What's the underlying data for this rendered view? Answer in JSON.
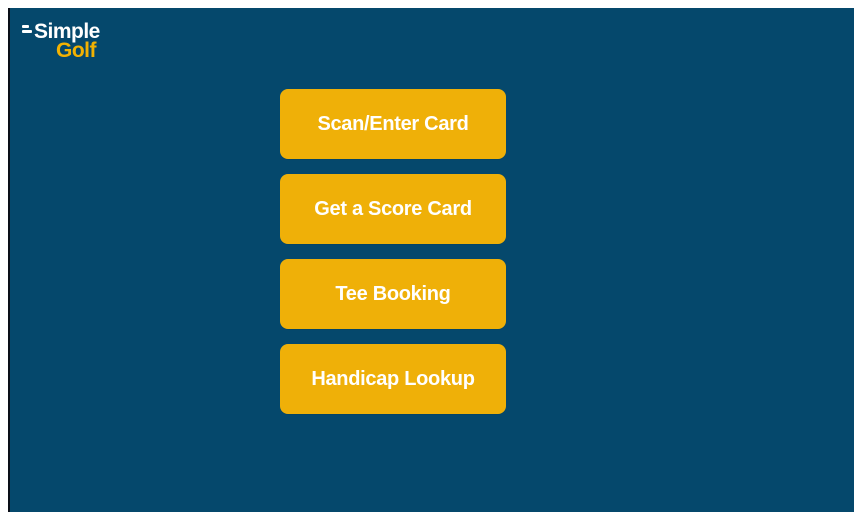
{
  "theme": {
    "background": "#05486c",
    "button": "#efb008",
    "button_text": "#ffffff",
    "logo_primary": "#ffffff",
    "logo_accent": "#f2b202"
  },
  "logo": {
    "line1": "Simple",
    "line2": "Golf",
    "icon": "logo-mark-icon"
  },
  "menu": {
    "items": [
      {
        "label": "Scan/Enter Card"
      },
      {
        "label": "Get a Score Card"
      },
      {
        "label": "Tee Booking"
      },
      {
        "label": "Handicap Lookup"
      }
    ]
  }
}
